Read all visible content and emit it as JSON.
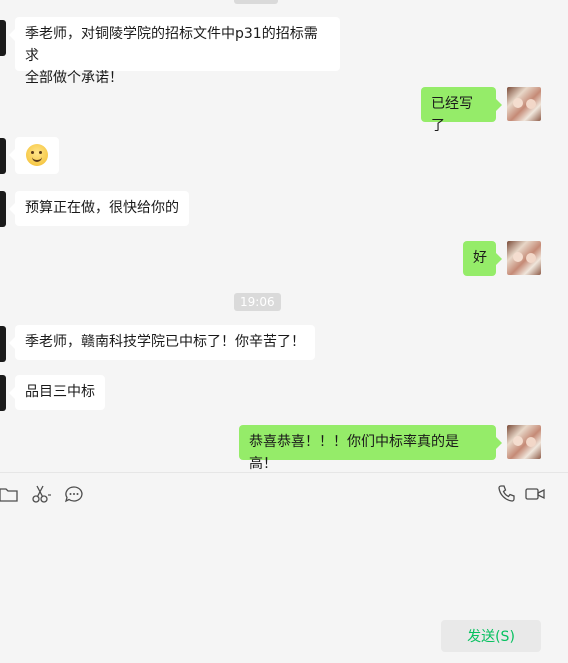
{
  "messages": [
    {
      "side": "left",
      "text_line1": "季老师，对铜陵学院的招标文件中p31的招标需求",
      "text_line2": "全部做个承诺！"
    },
    {
      "side": "right",
      "text": "已经写了"
    },
    {
      "side": "left",
      "emoji": "smile-emoji"
    },
    {
      "side": "left",
      "text": "预算正在做，很快给你的"
    },
    {
      "side": "right",
      "text": "好"
    },
    {
      "side": "left",
      "text": "季老师，赣南科技学院已中标了！你辛苦了！"
    },
    {
      "side": "left",
      "text": "品目三中标"
    },
    {
      "side": "right",
      "text": "恭喜恭喜！！！你们中标率真的是高！"
    }
  ],
  "timestamp": "19:06",
  "toolbar": {
    "icons": [
      "folder-icon",
      "scissors-icon",
      "chat-bubble-icon",
      "phone-icon",
      "video-call-icon"
    ]
  },
  "input": {
    "value": ""
  },
  "send_button": {
    "label": "发送(S)",
    "color": "#07c160"
  },
  "colors": {
    "self_bubble": "#95ec69",
    "other_bubble": "#ffffff",
    "background": "#f5f5f5"
  }
}
